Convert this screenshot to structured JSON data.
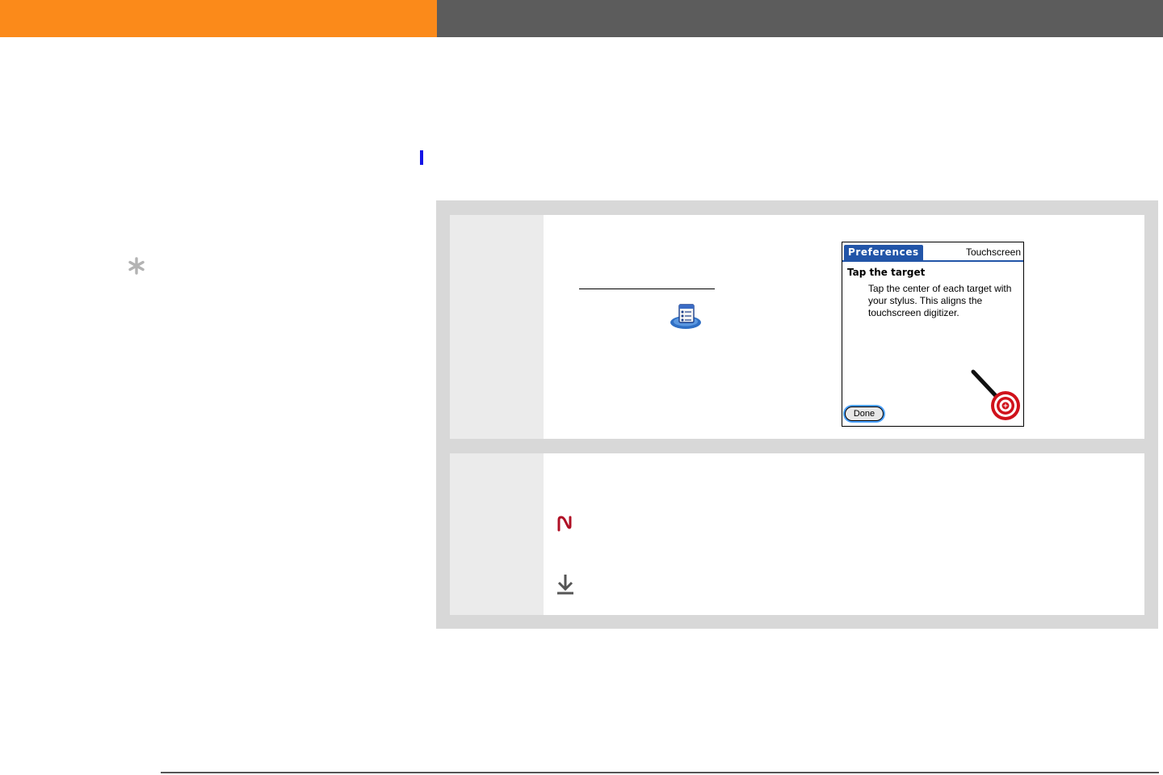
{
  "colors": {
    "header_orange": "#fb8a1a",
    "header_gray": "#5c5c5c",
    "marker_blue": "#1414e6",
    "panel_gray": "#d8d8d8",
    "palm_blue": "#2255a8",
    "target_red": "#d0121b"
  },
  "icons": {
    "tip": "asterisk-icon",
    "app": "preferences-app-icon",
    "note": "palm-note-icon",
    "download": "download-arrow-icon"
  },
  "palm_screen": {
    "tab_label": "Preferences",
    "title": "Touchscreen",
    "heading": "Tap the target",
    "instructions": "Tap the center of each target with your stylus.  This aligns the touchscreen digitizer.",
    "done_button": "Done"
  }
}
